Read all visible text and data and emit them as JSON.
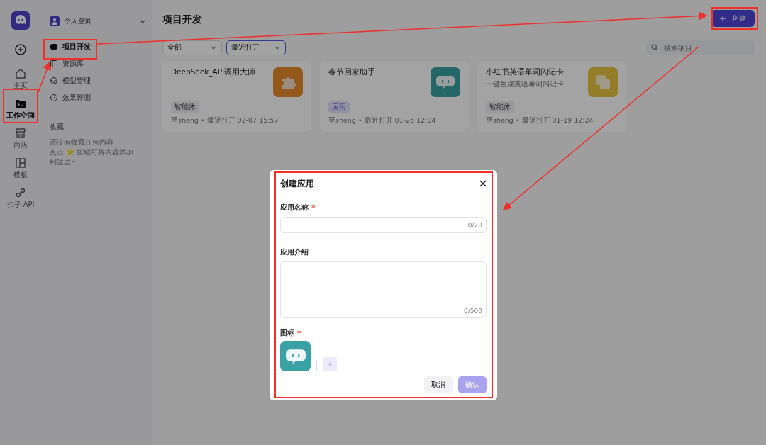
{
  "rail": {
    "items": [
      {
        "label": "主页",
        "selected": false
      },
      {
        "label": "工作空间",
        "selected": true
      },
      {
        "label": "商店",
        "selected": false
      },
      {
        "label": "模板",
        "selected": false
      },
      {
        "label": "扣子 API",
        "selected": false
      }
    ]
  },
  "workspace": {
    "name": "个人空间"
  },
  "nav": {
    "items": [
      {
        "label": "项目开发",
        "selected": true
      },
      {
        "label": "资源库",
        "selected": false
      },
      {
        "label": "模型管理",
        "selected": false
      },
      {
        "label": "效果评测",
        "selected": false
      }
    ]
  },
  "favorites": {
    "title": "收藏",
    "empty_text": "还没有收藏任何内容",
    "hint": "点击 ⭐ 按钮可将内容添加到这里~"
  },
  "main": {
    "title": "项目开发",
    "create_button": "创建",
    "search": {
      "placeholder": "搜索项目"
    },
    "filters": [
      {
        "value": "全部",
        "focused": false
      },
      {
        "value": "最近打开",
        "focused": true
      }
    ],
    "cards": [
      {
        "title": "DeepSeek_API调用大师",
        "tag": "智能体",
        "kind": "agent",
        "meta": "至sheng • 最近打开 02-07 15:57"
      },
      {
        "title": "春节回家助手",
        "tag": "应用",
        "kind": "app",
        "meta": "至sheng • 最近打开 01-26 12:04"
      },
      {
        "title": "小红书英语单词闪记卡",
        "subtitle": "一键生成英语单词闪记卡",
        "tag": "智能体",
        "kind": "agent",
        "meta": "至sheng • 最近打开 01-19 12:24"
      }
    ]
  },
  "dialog": {
    "title": "创建应用",
    "name_label": "应用名称",
    "name_mark": "*",
    "name_counter": "0/20",
    "intro_label": "应用介绍",
    "intro_counter": "0/500",
    "icon_label": "图标",
    "icon_mark": "*",
    "buttons": [
      {
        "label": "取消",
        "kind": "secondary",
        "disabled": false
      },
      {
        "label": "确认",
        "kind": "primary",
        "disabled": true
      }
    ]
  }
}
